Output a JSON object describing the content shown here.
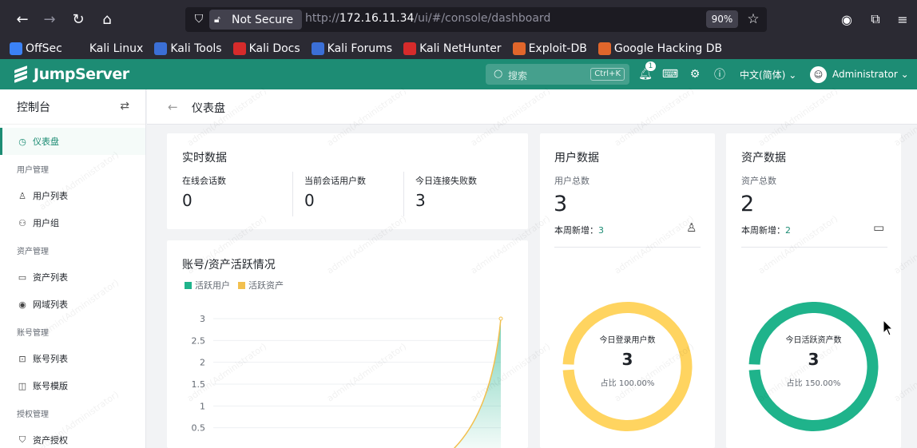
{
  "browser": {
    "security_label": "Not Secure",
    "url_prefix": "http://",
    "url_host": "172.16.11.34",
    "url_path": "/ui/#/console/dashboard",
    "zoom": "90%"
  },
  "bookmarks": [
    {
      "label": "OffSec",
      "icon": "offsec-icon",
      "color": "#3b82f6"
    },
    {
      "label": "Kali Linux",
      "icon": "kali-dragon-icon",
      "color": "#2b2a33"
    },
    {
      "label": "Kali Tools",
      "icon": "kali-tools-icon",
      "color": "#3b6fd6"
    },
    {
      "label": "Kali Docs",
      "icon": "kali-docs-icon",
      "color": "#d62b2b"
    },
    {
      "label": "Kali Forums",
      "icon": "kali-forums-icon",
      "color": "#3b6fd6"
    },
    {
      "label": "Kali NetHunter",
      "icon": "kali-nethunter-icon",
      "color": "#d62b2b"
    },
    {
      "label": "Exploit-DB",
      "icon": "exploit-db-icon",
      "color": "#e0662b"
    },
    {
      "label": "Google Hacking DB",
      "icon": "ghdb-icon",
      "color": "#e0662b"
    }
  ],
  "header": {
    "brand": "JumpServer",
    "search_placeholder": "搜索",
    "search_shortcut": "Ctrl+K",
    "notification_count": "1",
    "language": "中文(简体)",
    "user": "Administrator"
  },
  "sidebar": {
    "title": "控制台",
    "items": [
      {
        "type": "item",
        "label": "仪表盘",
        "icon": "dashboard-icon",
        "glyph": "◷",
        "active": true
      },
      {
        "type": "group",
        "label": "用户管理"
      },
      {
        "type": "item",
        "label": "用户列表",
        "icon": "user-icon",
        "glyph": "♙"
      },
      {
        "type": "item",
        "label": "用户组",
        "icon": "user-group-icon",
        "glyph": "⚇"
      },
      {
        "type": "group",
        "label": "资产管理"
      },
      {
        "type": "item",
        "label": "资产列表",
        "icon": "monitor-icon",
        "glyph": "▭"
      },
      {
        "type": "item",
        "label": "网域列表",
        "icon": "location-icon",
        "glyph": "◉"
      },
      {
        "type": "group",
        "label": "账号管理"
      },
      {
        "type": "item",
        "label": "账号列表",
        "icon": "lock-icon",
        "glyph": "⊡"
      },
      {
        "type": "item",
        "label": "账号模版",
        "icon": "template-icon",
        "glyph": "◫"
      },
      {
        "type": "group",
        "label": "授权管理"
      },
      {
        "type": "item",
        "label": "资产授权",
        "icon": "shield-check-icon",
        "glyph": "⛉"
      }
    ]
  },
  "breadcrumb": {
    "title": "仪表盘"
  },
  "realtime": {
    "title": "实时数据",
    "stats": [
      {
        "label": "在线会话数",
        "value": "0"
      },
      {
        "label": "当前会话用户数",
        "value": "0"
      },
      {
        "label": "今日连接失败数",
        "value": "3"
      }
    ]
  },
  "users_card": {
    "title": "用户数据",
    "total_label": "用户总数",
    "total_value": "3",
    "week_label": "本周新增：",
    "week_value": "3",
    "ring_label": "今日登录用户数",
    "ring_value": "3",
    "ring_ratio": "占比 100.00%",
    "ring_color": "#ffd460",
    "ring_fraction": 0.985
  },
  "assets_card": {
    "title": "资产数据",
    "total_label": "资产总数",
    "total_value": "2",
    "week_label": "本周新增：",
    "week_value": "2",
    "ring_label": "今日活跃资产数",
    "ring_value": "3",
    "ring_ratio": "占比 150.00%",
    "ring_color": "#1fb38b",
    "ring_fraction": 0.985
  },
  "watermark_text": "admin(Administrator)",
  "chart_data": {
    "type": "area",
    "title": "账号/资产活跃情况",
    "series": [
      {
        "name": "活跃用户",
        "color": "#1fb38b"
      },
      {
        "name": "活跃资产",
        "color": "#f2c04e"
      }
    ],
    "y_ticks": [
      "3",
      "2.5",
      "2",
      "1.5",
      "1",
      "0.5"
    ],
    "ylim": [
      0,
      3
    ],
    "last_value": 3
  }
}
